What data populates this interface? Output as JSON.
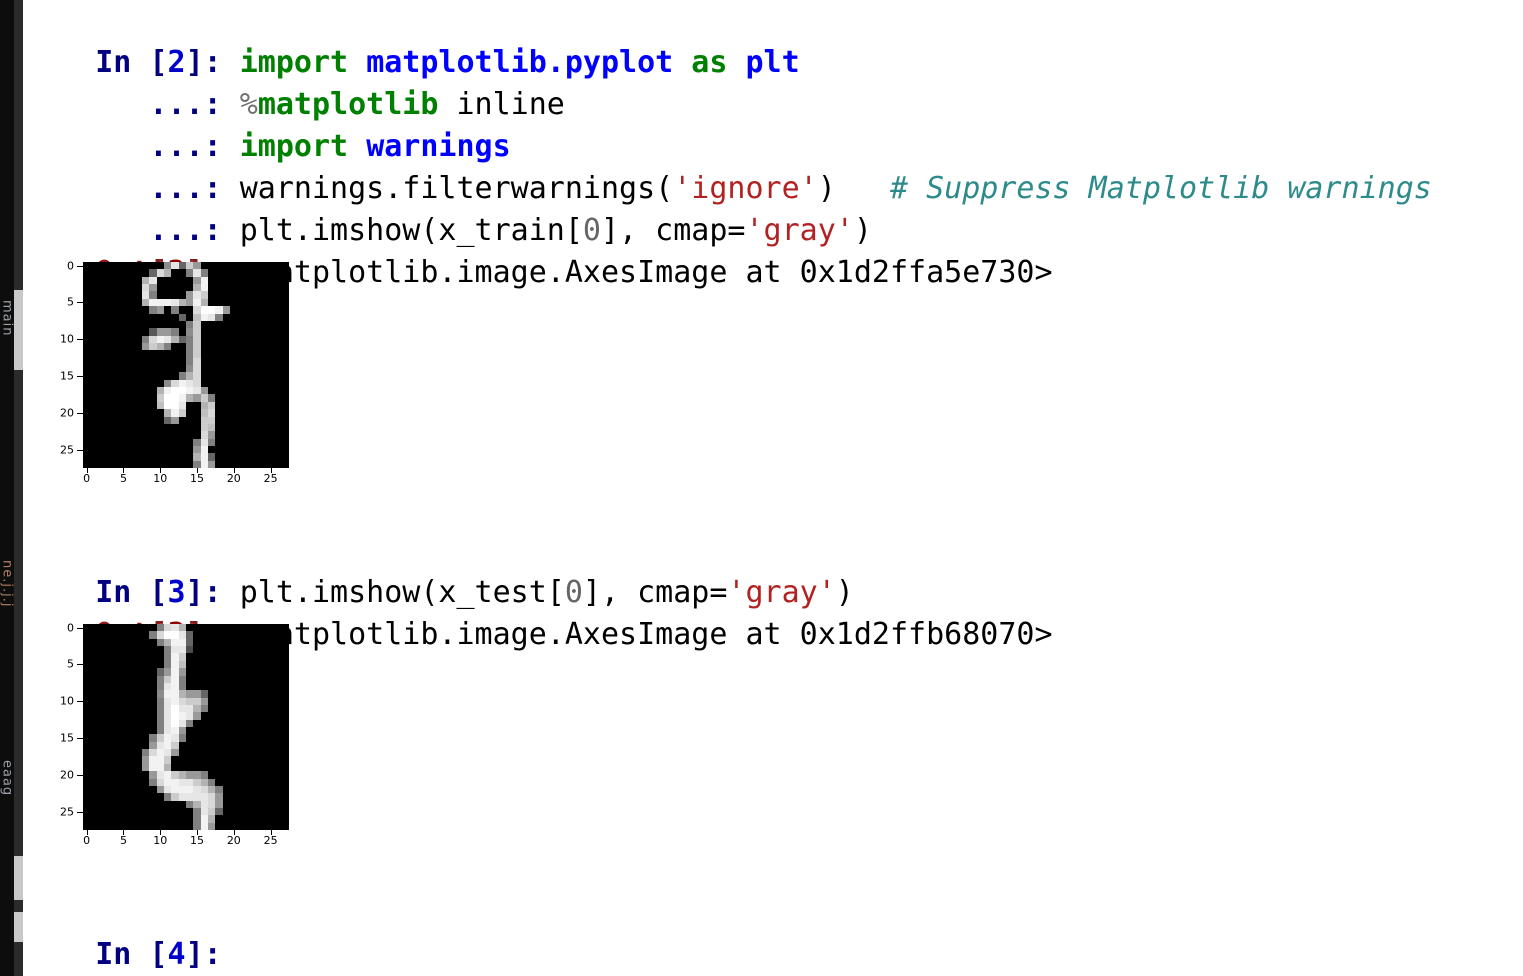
{
  "app": {
    "type": "ipython-console",
    "background": "#ffffff"
  },
  "left_strip": {
    "labels": [
      "main",
      "ne.j.j.j",
      "eaag"
    ],
    "background": "#0d0d0d"
  },
  "colors": {
    "prompt_in": "#000080",
    "prompt_out": "#8b1a1a",
    "keyword": "#008000",
    "module": "#0000ff",
    "string": "#b22222",
    "comment": "#2e8b8b",
    "number": "#666666",
    "plain": "#000000"
  },
  "cells": [
    {
      "prompt": "In [2]: ",
      "prompt_label": "In [",
      "prompt_number": "2",
      "prompt_close": "]: ",
      "lines": [
        {
          "cont": "",
          "tokens": [
            {
              "t": "import",
              "c": "kw"
            },
            {
              "t": " ",
              "c": "plain"
            },
            {
              "t": "matplotlib.pyplot",
              "c": "mod"
            },
            {
              "t": " ",
              "c": "plain"
            },
            {
              "t": "as",
              "c": "kw"
            },
            {
              "t": " ",
              "c": "plain"
            },
            {
              "t": "plt",
              "c": "mod"
            }
          ]
        },
        {
          "cont": "   ...: ",
          "tokens": [
            {
              "t": "%",
              "c": "magic-pc"
            },
            {
              "t": "matplotlib",
              "c": "kw"
            },
            {
              "t": " inline",
              "c": "plain"
            }
          ]
        },
        {
          "cont": "   ...: ",
          "tokens": [
            {
              "t": "import",
              "c": "kw"
            },
            {
              "t": " ",
              "c": "plain"
            },
            {
              "t": "warnings",
              "c": "mod"
            }
          ]
        },
        {
          "cont": "   ...: ",
          "tokens": [
            {
              "t": "warnings.filterwarnings(",
              "c": "plain"
            },
            {
              "t": "'ignore'",
              "c": "str"
            },
            {
              "t": ")   ",
              "c": "plain"
            },
            {
              "t": "# Suppress Matplotlib warnings",
              "c": "cmt"
            }
          ]
        },
        {
          "cont": "   ...: ",
          "tokens": [
            {
              "t": "plt.imshow(x_train[",
              "c": "plain"
            },
            {
              "t": "0",
              "c": "num"
            },
            {
              "t": "], cmap=",
              "c": "plain"
            },
            {
              "t": "'gray'",
              "c": "str"
            },
            {
              "t": ")",
              "c": "plain"
            }
          ]
        }
      ]
    }
  ],
  "out2": {
    "prompt_label": "Out[",
    "prompt_number": "2",
    "prompt_close": "]: ",
    "text": "<matplotlib.image.AxesImage at 0x1d2ffa5e730>"
  },
  "in3": {
    "prompt_label": "In [",
    "prompt_number": "3",
    "prompt_close": "]: ",
    "tokens": [
      {
        "t": "plt.imshow(x_test[",
        "c": "plain"
      },
      {
        "t": "0",
        "c": "num"
      },
      {
        "t": "], cmap=",
        "c": "plain"
      },
      {
        "t": "'gray'",
        "c": "str"
      },
      {
        "t": ")",
        "c": "plain"
      }
    ]
  },
  "out3": {
    "prompt_label": "Out[",
    "prompt_number": "3",
    "prompt_close": "]: ",
    "text": "<matplotlib.image.AxesImage at 0x1d2ffb68070>"
  },
  "in4": {
    "prompt_label": "In [",
    "prompt_number": "4",
    "prompt_close": "]:",
    "tokens": []
  },
  "chart_data": [
    {
      "type": "heatmap",
      "name": "x_train[0] MNIST digit",
      "cmap": "gray",
      "title": "",
      "xlabel": "",
      "ylabel": "",
      "xlim": [
        -0.5,
        27.5
      ],
      "ylim": [
        27.5,
        -0.5
      ],
      "xticks": [
        0,
        5,
        10,
        15,
        20,
        25
      ],
      "yticks": [
        0,
        5,
        10,
        15,
        20,
        25
      ],
      "grid": false,
      "shape": [
        28,
        28
      ],
      "pixels": [
        "0000000000000000000000000000",
        "0000000000000000000000000000",
        "0000000000000000000000000000",
        "0000000068ba9589ca8400000000",
        "00000000a9642026c9a50000 0000",
        "0000000cb3001004a8d1000000 0",
        "00000008d5224a8cffc900000000",
        "0000000049ceffc86ff7cc9c6000",
        "000000000020301089fffffb9000",
        "00000000000000009cda54201000",
        "0000000000000000bcd100000000",
        "000000006a8b9bb9ccc000000000",
        "000000a9dcdbba97ccc000000000",
        "00000086a4200000a9dc000000000",
        "0000000000000000b7d80000 000",
        "00000000000000009ad900000000",
        "000000000000468bdce300000000",
        "0000000069cfffffffff50000000",
        "00000009dffffffffcbb200 0000",
        "0000000bffffffffd9bdb0000000",
        "000000069dfffeb9800cdb0000000",
        "00000000348cb8620009dc0000000",
        "0000000000000000000acd000000",
        "00000000000000000009cd0000000",
        "0000000000000000000bc90000000",
        "0000000000000000000ad90000000",
        "000000000000000000089d0000000",
        "00000000000000000005fd0000000"
      ]
    },
    {
      "type": "heatmap",
      "name": "x_test[0] MNIST digit",
      "cmap": "gray",
      "title": "",
      "xlabel": "",
      "ylabel": "",
      "xlim": [
        -0.5,
        27.5
      ],
      "ylim": [
        27.5,
        -0.5
      ],
      "xticks": [
        0,
        5,
        10,
        15,
        20,
        25
      ],
      "yticks": [
        0,
        5,
        10,
        15,
        20,
        25
      ],
      "grid": false,
      "shape": [
        28,
        28
      ]
    }
  ]
}
